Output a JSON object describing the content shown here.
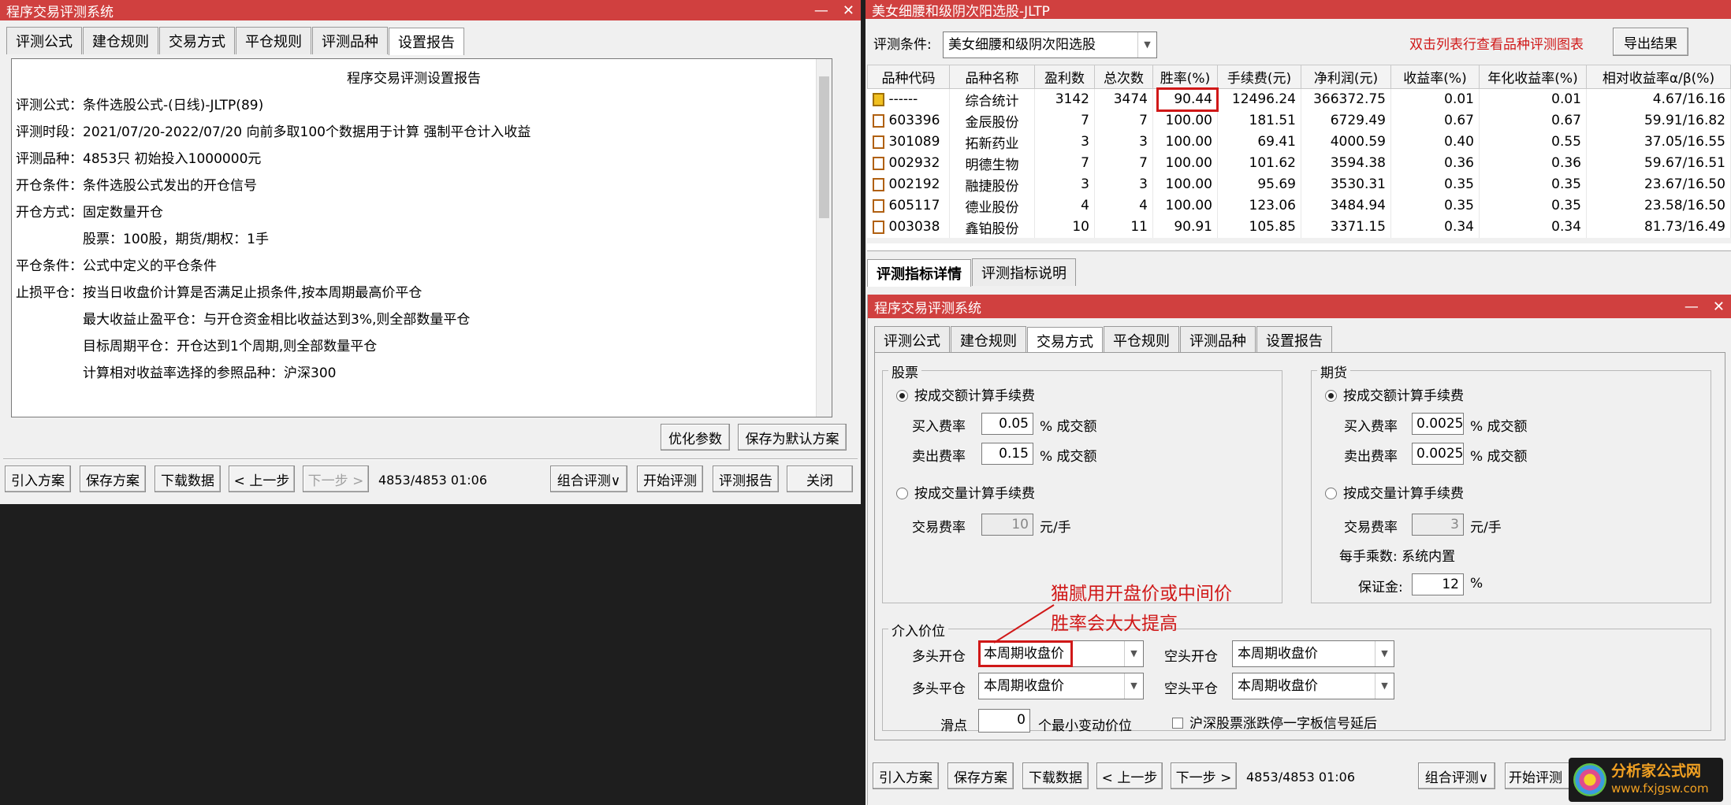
{
  "left_window": {
    "title": "程序交易评测系统",
    "tabs": [
      "评测公式",
      "建仓规则",
      "交易方式",
      "平仓规则",
      "评测品种",
      "设置报告"
    ],
    "report_title": "程序交易评测设置报告",
    "report_lines": [
      "评测公式：条件选股公式-(日线)-JLTP(89)",
      "评测时段：2021/07/20-2022/07/20 向前多取100个数据用于计算 强制平仓计入收益",
      "评测品种：4853只 初始投入1000000元",
      "开仓条件：条件选股公式发出的开仓信号",
      "开仓方式：固定数量开仓",
      "　　　　　股票：100股，期货/期权：1手",
      "平仓条件：公式中定义的平仓条件",
      "止损平仓：按当日收盘价计算是否满足止损条件,按本周期最高价平仓",
      "　　　　　最大收益止盈平仓：与开仓资金相比收益达到3%,则全部数量平仓",
      "　　　　　目标周期平仓：开仓达到1个周期,则全部数量平仓",
      "　　　　　计算相对收益率选择的参照品种：沪深300"
    ],
    "opt_btn": "优化参数",
    "save_default_btn": "保存为默认方案",
    "bottom_buttons": {
      "import": "引入方案",
      "save": "保存方案",
      "download": "下载数据",
      "prev": "< 上一步",
      "next": "下一步 >",
      "combo": "组合评测∨",
      "start": "开始评测",
      "report": "评测报告",
      "close": "关闭"
    },
    "status": "4853/4853  01:06"
  },
  "right_window": {
    "title": "美女细腰和级阴次阳选股-JLTP",
    "cond_label": "评测条件:",
    "cond_value": "美女细腰和级阴次阳选股",
    "hint": "双击列表行查看品种评测图表",
    "export_btn": "导出结果",
    "headers": [
      "品种代码",
      "品种名称",
      "盈利数",
      "总次数",
      "胜率(%)",
      "手续费(元)",
      "净利润(元)",
      "收益率(%)",
      "年化收益率(%)",
      "相对收益率α/β(%)"
    ],
    "rows": [
      [
        "------",
        "综合统计",
        "3142",
        "3474",
        "90.44",
        "12496.24",
        "366372.75",
        "0.01",
        "0.01",
        "4.67/16.16"
      ],
      [
        "603396",
        "金辰股份",
        "7",
        "7",
        "100.00",
        "181.51",
        "6729.49",
        "0.67",
        "0.67",
        "59.91/16.82"
      ],
      [
        "301089",
        "拓新药业",
        "3",
        "3",
        "100.00",
        "69.41",
        "4000.59",
        "0.40",
        "0.55",
        "37.05/16.55"
      ],
      [
        "002932",
        "明德生物",
        "7",
        "7",
        "100.00",
        "101.62",
        "3594.38",
        "0.36",
        "0.36",
        "59.67/16.51"
      ],
      [
        "002192",
        "融捷股份",
        "3",
        "3",
        "100.00",
        "95.69",
        "3530.31",
        "0.35",
        "0.35",
        "23.67/16.50"
      ],
      [
        "605117",
        "德业股份",
        "4",
        "4",
        "100.00",
        "123.06",
        "3484.94",
        "0.35",
        "0.35",
        "23.58/16.50"
      ],
      [
        "003038",
        "鑫铂股份",
        "10",
        "11",
        "90.91",
        "105.85",
        "3371.15",
        "0.34",
        "0.34",
        "81.73/16.49"
      ]
    ],
    "bottom_tabs": [
      "评测指标详情",
      "评测指标说明"
    ]
  },
  "inner_window": {
    "title": "程序交易评测系统",
    "tabs": [
      "评测公式",
      "建仓规则",
      "交易方式",
      "平仓规则",
      "评测品种",
      "设置报告"
    ],
    "stock": {
      "title": "股票",
      "by_amount": "按成交额计算手续费",
      "buy_label": "买入费率",
      "buy_value": "0.05",
      "buy_unit": "% 成交额",
      "sell_label": "卖出费率",
      "sell_value": "0.15",
      "sell_unit": "% 成交额",
      "by_volume": "按成交量计算手续费",
      "fee_label": "交易费率",
      "fee_value": "10",
      "fee_unit": "元/手"
    },
    "futures": {
      "title": "期货",
      "by_amount": "按成交额计算手续费",
      "buy_label": "买入费率",
      "buy_value": "0.0025",
      "buy_unit": "% 成交额",
      "sell_label": "卖出费率",
      "sell_value": "0.0025",
      "sell_unit": "% 成交额",
      "by_volume": "按成交量计算手续费",
      "fee_label": "交易费率",
      "fee_value": "3",
      "fee_unit": "元/手",
      "mult_text": "每手乘数: 系统内置",
      "margin_label": "保证金:",
      "margin_value": "12",
      "margin_unit": "%"
    },
    "entry": {
      "title": "介入价位",
      "long_open": "多头开仓",
      "long_open_val": "本周期收盘价",
      "short_open": "空头开仓",
      "short_open_val": "本周期收盘价",
      "long_close": "多头平仓",
      "long_close_val": "本周期收盘价",
      "short_close": "空头平仓",
      "short_close_val": "本周期收盘价",
      "slip_label": "滑点",
      "slip_value": "0",
      "slip_unit": "个最小变动价位",
      "delay_text": "沪深股票涨跌停一字板信号延后"
    },
    "annotation": [
      "猫腻用开盘价或中间价",
      "胜率会大大提高"
    ],
    "bottom_buttons": {
      "import": "引入方案",
      "save": "保存方案",
      "download": "下载数据",
      "prev": "< 上一步",
      "next": "下一步 >",
      "combo": "组合评测∨",
      "start": "开始评测"
    },
    "status": "4853/4853  01:06"
  },
  "watermark": {
    "name": "分析家公式网",
    "url": "www.fxjgsw.com"
  },
  "colors": {
    "titlebar": "#d0403f",
    "annotation": "#d01818"
  }
}
